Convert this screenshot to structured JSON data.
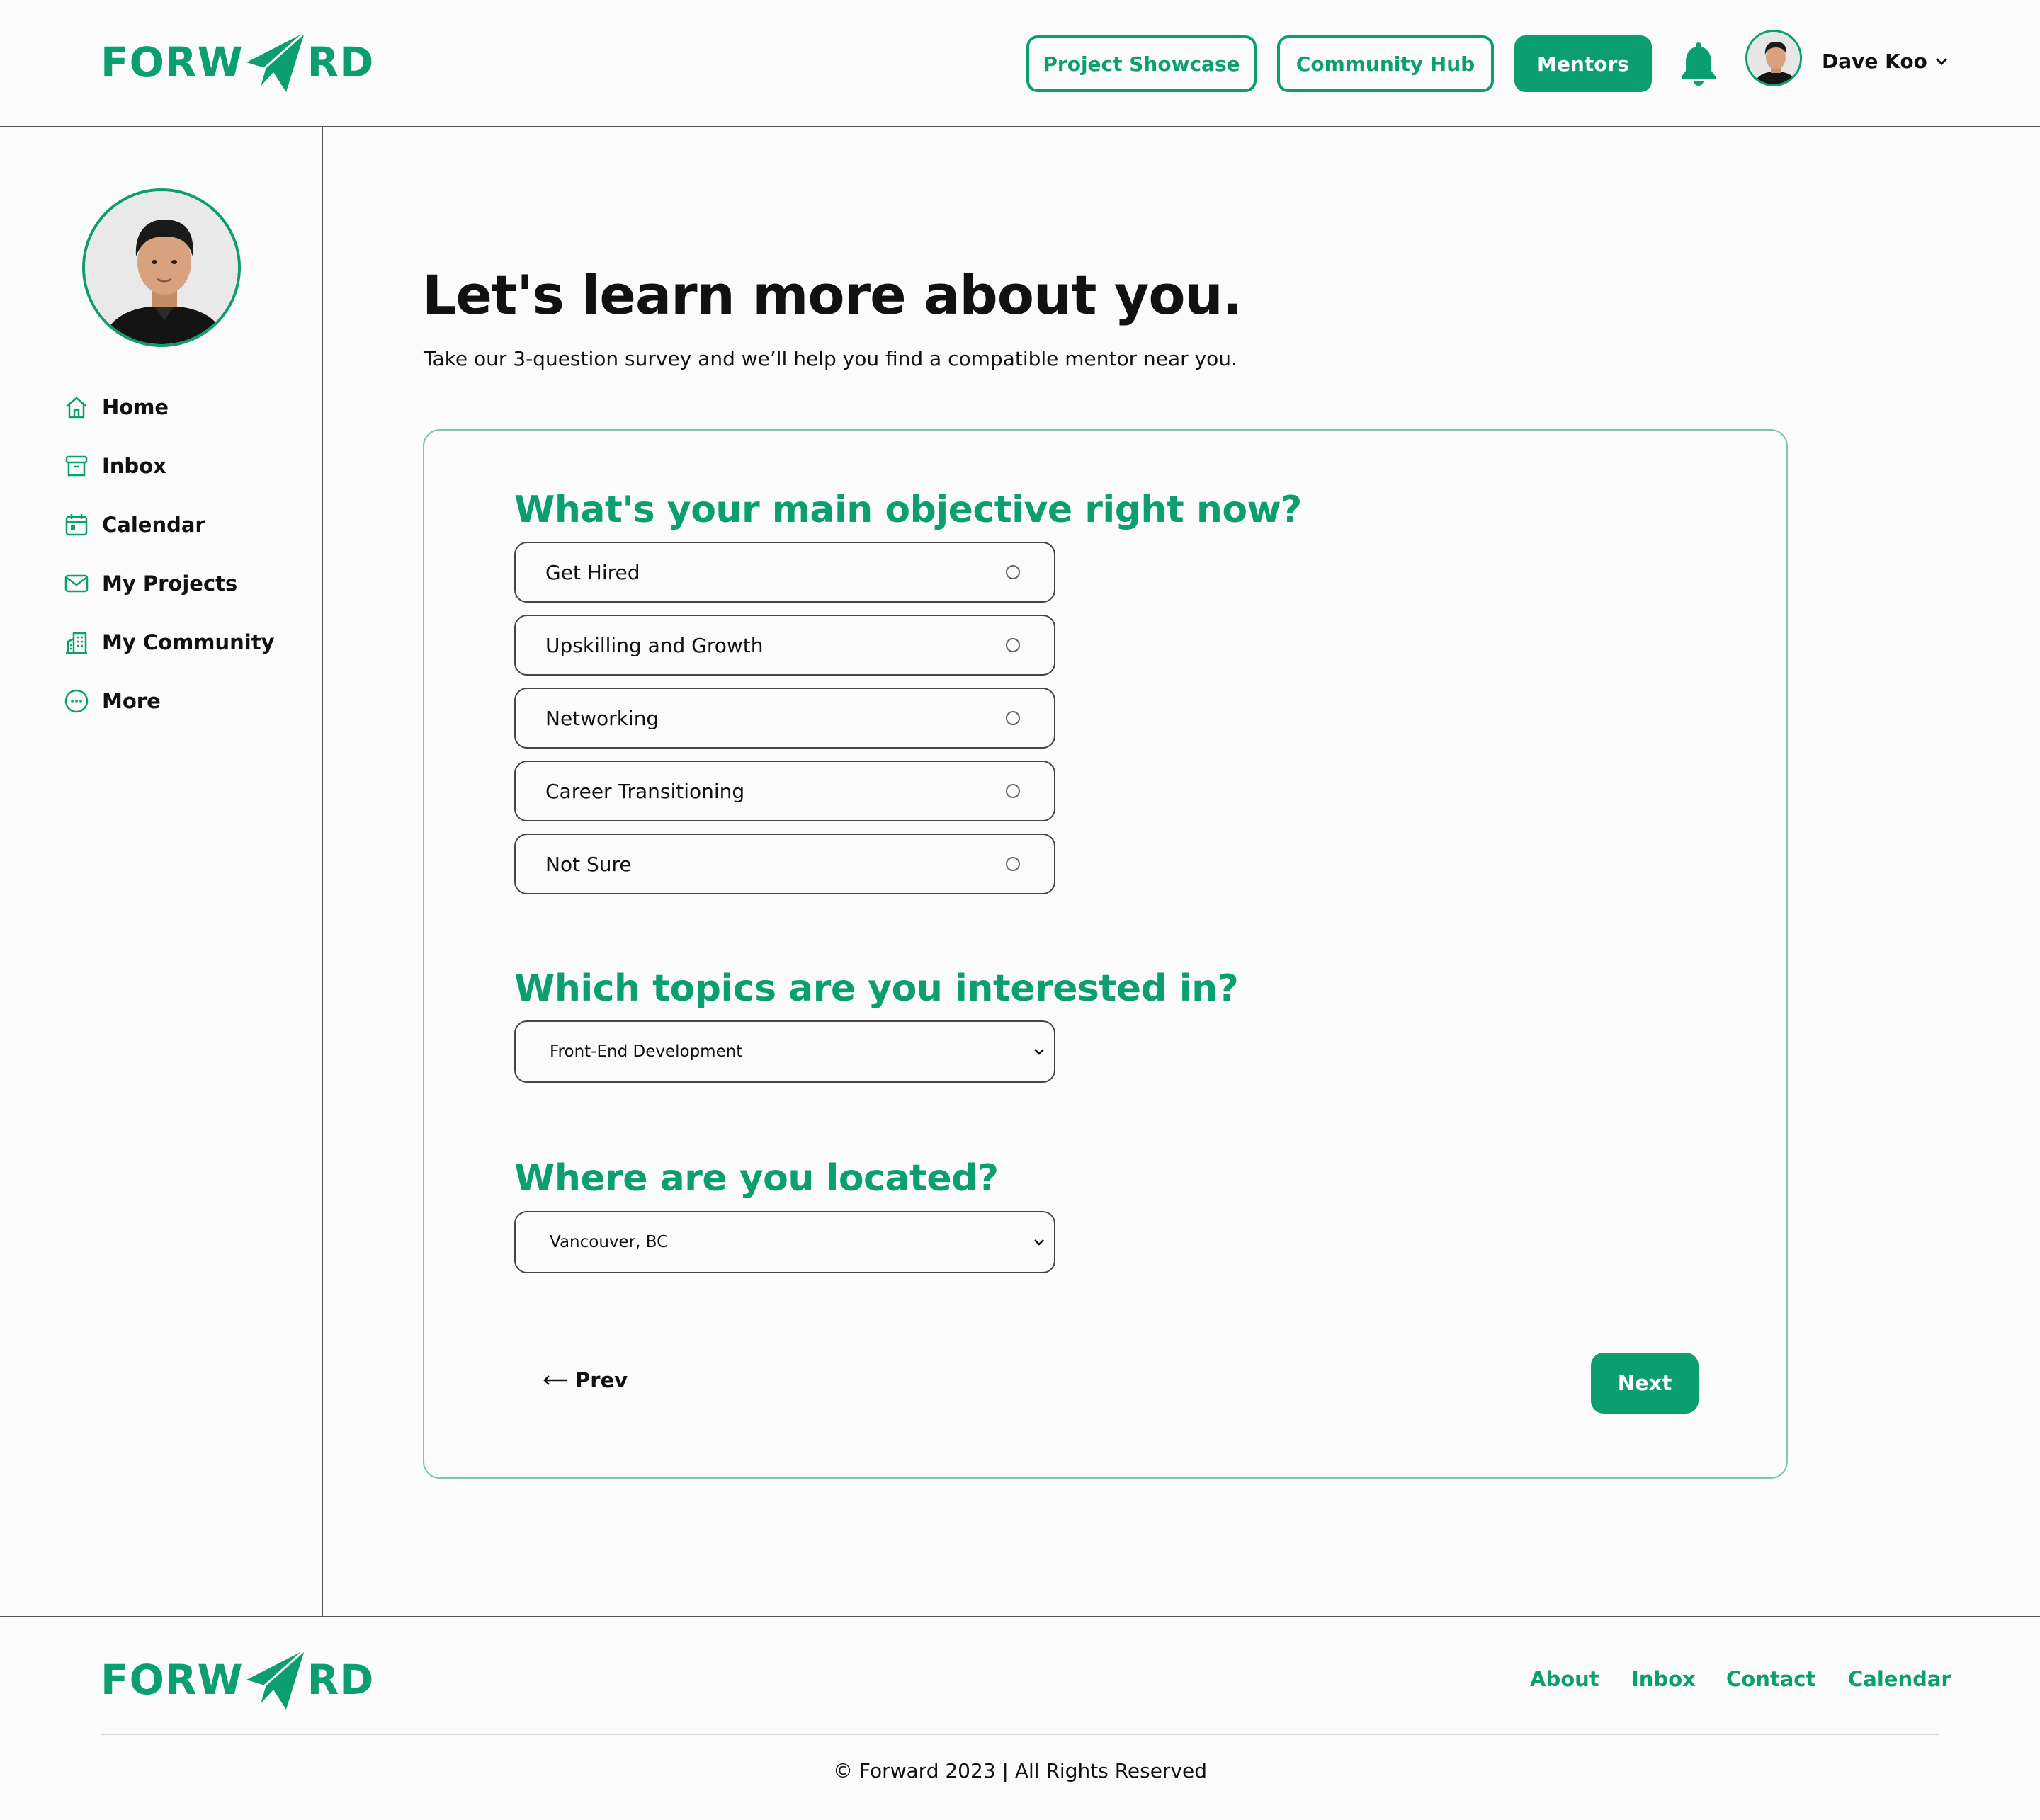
{
  "brand": {
    "logo_left": "FORW",
    "logo_right": "RD",
    "accent": "#0a9e70"
  },
  "header": {
    "nav": [
      {
        "label": "Project Showcase",
        "style": "outline"
      },
      {
        "label": "Community Hub",
        "style": "outline"
      },
      {
        "label": "Mentors",
        "style": "filled"
      }
    ],
    "notification_icon": "bell-icon",
    "user_name": "Dave Koo"
  },
  "sidebar": {
    "items": [
      {
        "label": "Home",
        "icon": "home-icon"
      },
      {
        "label": "Inbox",
        "icon": "inbox-icon"
      },
      {
        "label": "Calendar",
        "icon": "calendar-icon"
      },
      {
        "label": "My Projects",
        "icon": "mail-icon"
      },
      {
        "label": "My Community",
        "icon": "buildings-icon"
      },
      {
        "label": "More",
        "icon": "more-icon"
      }
    ]
  },
  "main": {
    "title": "Let's learn more about you.",
    "subtitle": "Take our 3-question survey and we’ll help you find a compatible mentor near you.",
    "q1": {
      "title": "What's your main objective right now?",
      "options": [
        "Get Hired",
        "Upskilling and Growth",
        "Networking",
        "Career Transitioning",
        "Not Sure"
      ]
    },
    "q2": {
      "title": "Which topics are you interested in?",
      "selected": "Front-End Development"
    },
    "q3": {
      "title": "Where are you located?",
      "selected": "Vancouver, BC"
    },
    "prev_label": "Prev",
    "next_label": "Next"
  },
  "footer": {
    "links": [
      "About",
      "Inbox",
      "Contact",
      "Calendar"
    ],
    "copyright": "© Forward 2023 | All Rights Reserved"
  }
}
